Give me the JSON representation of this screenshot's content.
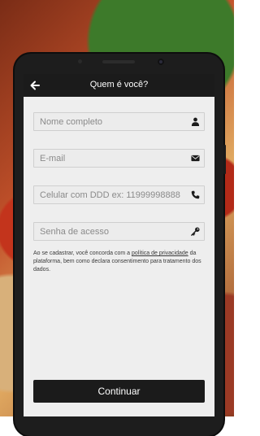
{
  "header": {
    "title": "Quem é você?"
  },
  "form": {
    "name_placeholder": "Nome completo",
    "email_placeholder": "E-mail",
    "phone_placeholder": "Celular com DDD ex: 11999998888",
    "password_placeholder": "Senha de acesso"
  },
  "terms": {
    "before": "Ao se cadastrar, você concorda com a ",
    "link": "política de privacidade",
    "after": " da plataforma, bem como declara consentimento para tratamento dos dados."
  },
  "actions": {
    "continue_label": "Continuar"
  },
  "icons": {
    "back": "arrow-left",
    "name": "user",
    "email": "envelope",
    "phone": "phone",
    "password": "key"
  },
  "colors": {
    "header": "#1b1b1b",
    "button": "#1b1b1b",
    "screen": "#eeeeee"
  }
}
